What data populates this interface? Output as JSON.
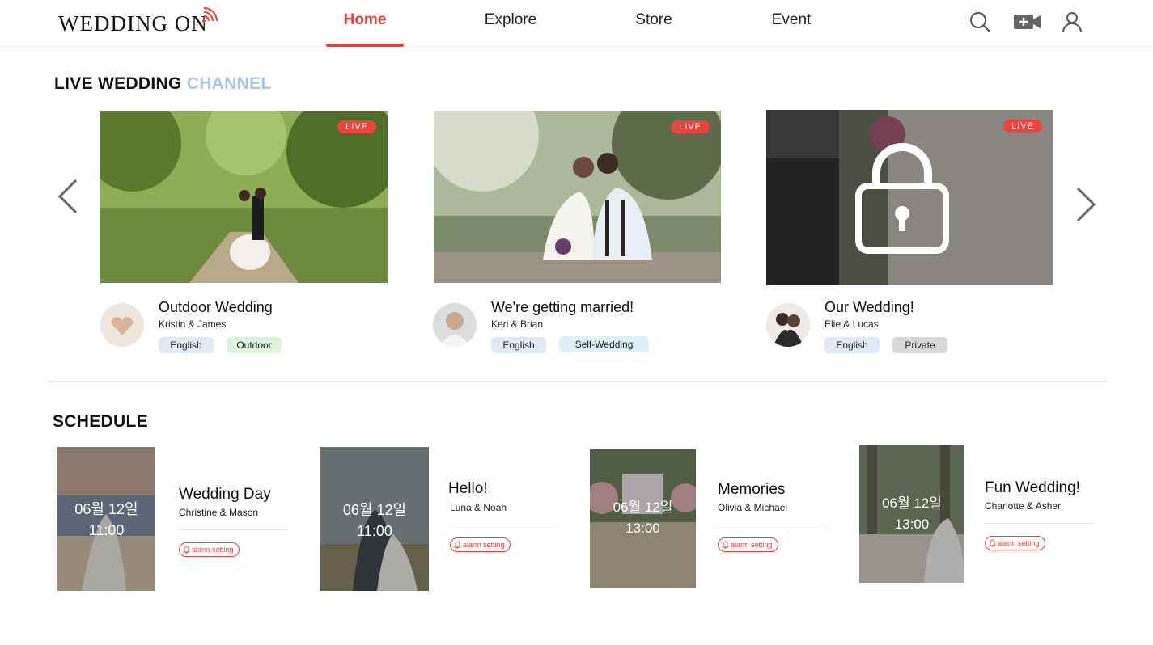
{
  "app": {
    "logo": "WEDDING ON"
  },
  "nav": {
    "items": [
      "Home",
      "Explore",
      "Store",
      "Event"
    ],
    "active": "Home"
  },
  "header_icons": [
    "search-icon",
    "add-video-icon",
    "user-icon"
  ],
  "live": {
    "title_main": "LIVE WEDDING",
    "title_accent": "CHANNEL",
    "cards": [
      {
        "badge": "LIVE",
        "title": "Outdoor Wedding",
        "couple": "Kristin & James",
        "tags": [
          "English",
          "Outdoor"
        ]
      },
      {
        "badge": "LIVE",
        "title": "We're getting married!",
        "couple": "Keri & Brian",
        "tags": [
          "English",
          "Self-Wedding"
        ]
      },
      {
        "badge": "LIVE",
        "title": "Our Wedding!",
        "couple": "Elie & Lucas",
        "tags": [
          "English",
          "Private"
        ],
        "locked": true
      }
    ]
  },
  "schedule": {
    "title": "SCHEDULE",
    "alarm_label": "alarm setting",
    "items": [
      {
        "date": "06월 12일",
        "time": "11:00",
        "title": "Wedding Day",
        "couple": "Christine & Mason"
      },
      {
        "date": "06월 12일",
        "time": "11:00",
        "title": "Hello!",
        "couple": "Luna & Noah"
      },
      {
        "date": "06월 12일",
        "time": "13:00",
        "title": "Memories",
        "couple": "Olivia & Michael"
      },
      {
        "date": "06월 12일",
        "time": "13:00",
        "title": "Fun Wedding!",
        "couple": "Charlotte & Asher"
      }
    ]
  },
  "colors": {
    "accent": "#e8403c",
    "live_badge": "#f0423c",
    "channel_accent": "#a8c4ea"
  }
}
